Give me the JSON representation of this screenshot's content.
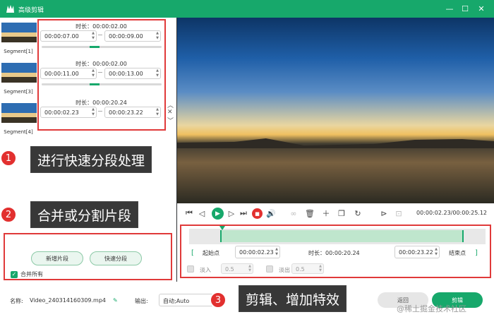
{
  "window": {
    "title": "高级剪辑",
    "minimize": "—",
    "maximize": "☐",
    "close": "✕",
    "accent": "#17a86b"
  },
  "segments": [
    {
      "label": "Segment[1]",
      "duration": "时长：00:00:02.00",
      "start": "00:00:07.00",
      "end": "00:00:09.00",
      "progress": 0.45
    },
    {
      "label": "Segment[3]",
      "duration": "时长：00:00:02.00",
      "start": "00:00:11.00",
      "end": "00:00:13.00",
      "progress": 0.45
    },
    {
      "label": "Segment[4]",
      "duration": "时长：00:00:20.24",
      "start": "00:00:02.23",
      "end": "00:00:23.22",
      "progress": 0.45
    }
  ],
  "side_buttons": {
    "up": "︿",
    "close": "✕",
    "down": "﹀"
  },
  "callouts": [
    {
      "num": "1",
      "text": "进行快速分段处理"
    },
    {
      "num": "2",
      "text": "合并或分割片段"
    },
    {
      "num": "3",
      "text": "剪辑、增加特效"
    }
  ],
  "left_buttons": {
    "new_segment": "新增片段",
    "quick_split": "快速分段",
    "merge_all": "合并所有"
  },
  "playback": {
    "timecode": "00:00:02.23/00:00:25.12"
  },
  "editor": {
    "start_label": "起始点",
    "start_value": "00:00:02.23",
    "duration_label": "时长：00:00:20.24",
    "end_value": "00:00:23.22",
    "end_label": "结束点",
    "fade_in_label": "淡入",
    "fade_in_value": "0.5",
    "fade_out_label": "淡出",
    "fade_out_value": "0.5"
  },
  "bottom": {
    "name_label": "名称:",
    "filename": "Video_240314160309.mp4",
    "output_label": "输出:",
    "output_value": "自动;Auto",
    "back_button": "返回",
    "edit_button": "剪辑",
    "watermark": "@稀土掘金技术社区"
  }
}
